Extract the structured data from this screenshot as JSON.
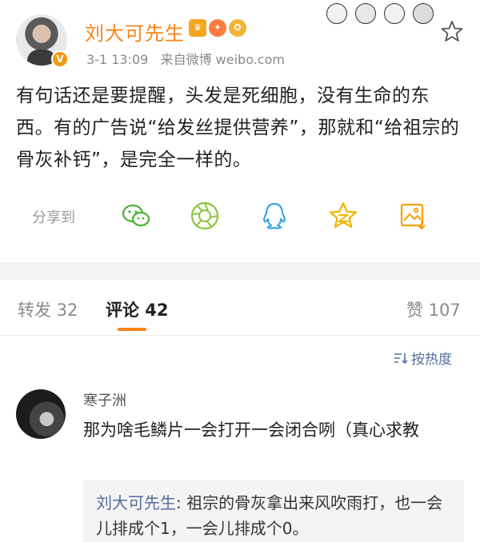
{
  "post": {
    "user_name": "刘大可先生",
    "verified_badge": "V",
    "badges": [
      {
        "icon": "crown-member-icon",
        "color": "#f5a623"
      },
      {
        "icon": "fire-icon",
        "color": "#ff7a3d"
      },
      {
        "icon": "medal-icon",
        "color": "#f2b336"
      }
    ],
    "timestamp": "3-1 13:09",
    "source": "来自微博 weibo.com",
    "text": "有句话还是要提醒，头发是死细胞，没有生命的东西。有的广告说“给发丝提供营养”，那就和“给祖宗的骨灰补钙”，是完全一样的。"
  },
  "share": {
    "label": "分享到",
    "targets": [
      {
        "name": "wechat-icon",
        "color": "#49b233"
      },
      {
        "name": "moments-icon",
        "color": "#8cc63f"
      },
      {
        "name": "qq-icon",
        "color": "#3ba6e6"
      },
      {
        "name": "qzone-icon",
        "color": "#f4b400"
      },
      {
        "name": "save-image-icon",
        "color": "#f4a100"
      }
    ]
  },
  "tabs": {
    "repost": "转发 32",
    "comments": "评论 42",
    "likes": "赞 107"
  },
  "sort": {
    "label": "按热度"
  },
  "comment": {
    "user": "寒子洲",
    "text": "那为啥毛鳞片一会打开一会闭合咧（真心求教",
    "reply_user": "刘大可先生",
    "reply_text": ": 祖宗的骨灰拿出来风吹雨打，也一会儿排成个1，一会儿排成个0。"
  },
  "colors": {
    "accent": "#f78418",
    "link": "#526e9d"
  }
}
